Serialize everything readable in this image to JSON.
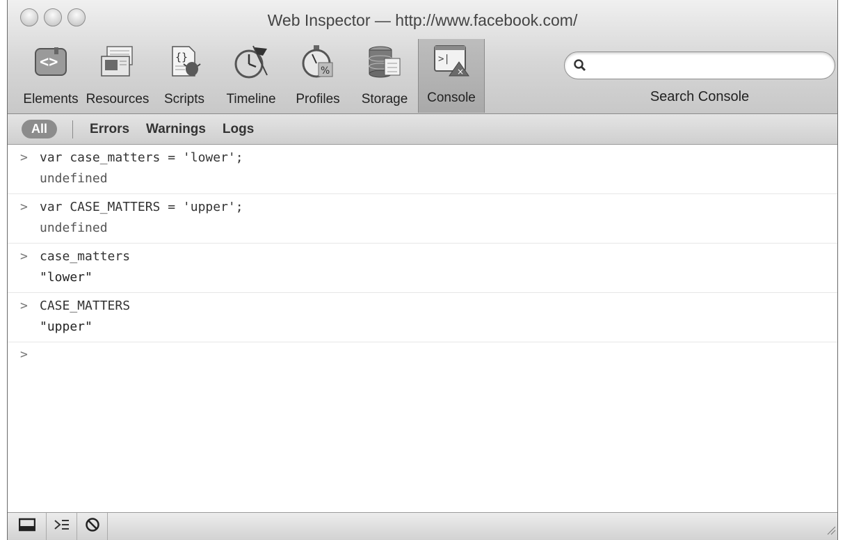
{
  "window": {
    "title": "Web Inspector — http://www.facebook.com/"
  },
  "toolbar": {
    "tools": [
      {
        "label": "Elements",
        "icon": "elements-icon"
      },
      {
        "label": "Resources",
        "icon": "resources-icon"
      },
      {
        "label": "Scripts",
        "icon": "scripts-icon"
      },
      {
        "label": "Timeline",
        "icon": "timeline-icon"
      },
      {
        "label": "Profiles",
        "icon": "profiles-icon"
      },
      {
        "label": "Storage",
        "icon": "storage-icon"
      },
      {
        "label": "Console",
        "icon": "console-icon",
        "active": true
      }
    ],
    "search": {
      "label": "Search Console",
      "value": "",
      "icon": "search-icon"
    }
  },
  "filters": {
    "all": "All",
    "errors": "Errors",
    "warnings": "Warnings",
    "logs": "Logs"
  },
  "console": {
    "prompt": ">",
    "entries": [
      {
        "command": "var case_matters = 'lower';",
        "result": "undefined"
      },
      {
        "command": "var CASE_MATTERS = 'upper';",
        "result": "undefined"
      },
      {
        "command": "case_matters",
        "result": "\"lower\""
      },
      {
        "command": "CASE_MATTERS",
        "result": "\"upper\""
      }
    ],
    "input_value": ""
  },
  "statusbar": {
    "icons": [
      "dock-icon",
      "console-drawer-icon",
      "clear-console-icon"
    ]
  }
}
